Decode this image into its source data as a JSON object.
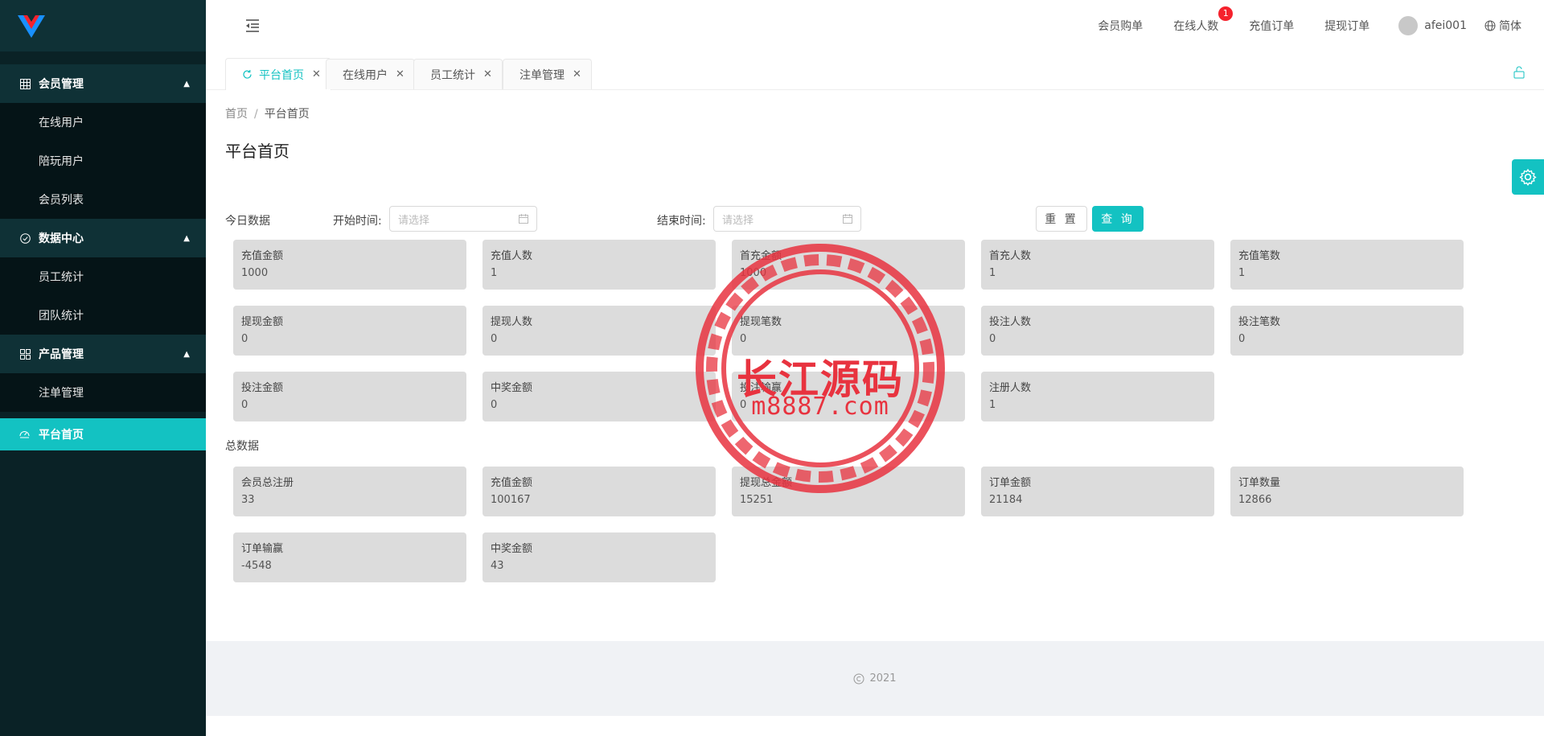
{
  "sidebar": {
    "groups": [
      {
        "label": "会员管理",
        "items": [
          "在线用户",
          "陪玩用户",
          "会员列表"
        ]
      },
      {
        "label": "数据中心",
        "items": [
          "员工统计",
          "团队统计"
        ]
      },
      {
        "label": "产品管理",
        "items": [
          "注单管理"
        ]
      }
    ],
    "active_item": "平台首页"
  },
  "header": {
    "nav": [
      "会员购单",
      "在线人数",
      "充值订单",
      "提现订单"
    ],
    "online_badge": "1",
    "user_name": "afei001",
    "language": "简体"
  },
  "tabs": [
    "平台首页",
    "在线用户",
    "员工统计",
    "注单管理"
  ],
  "breadcrumb": {
    "home": "首页",
    "current": "平台首页"
  },
  "page_title": "平台首页",
  "filter": {
    "section": "今日数据",
    "start_label": "开始时间:",
    "end_label": "结束时间:",
    "placeholder": "请选择",
    "reset": "重 置",
    "query": "查 询"
  },
  "today": [
    {
      "title": "充值金额",
      "value": "1000"
    },
    {
      "title": "充值人数",
      "value": "1"
    },
    {
      "title": "首充金额",
      "value": "1000"
    },
    {
      "title": "首充人数",
      "value": "1"
    },
    {
      "title": "充值笔数",
      "value": "1"
    },
    {
      "title": "提现金额",
      "value": "0"
    },
    {
      "title": "提现人数",
      "value": "0"
    },
    {
      "title": "提现笔数",
      "value": "0"
    },
    {
      "title": "投注人数",
      "value": "0"
    },
    {
      "title": "投注笔数",
      "value": "0"
    },
    {
      "title": "投注金额",
      "value": "0"
    },
    {
      "title": "中奖金额",
      "value": "0"
    },
    {
      "title": "投注输赢",
      "value": "0"
    },
    {
      "title": "注册人数",
      "value": "1"
    }
  ],
  "total_section": "总数据",
  "total": [
    {
      "title": "会员总注册",
      "value": "33"
    },
    {
      "title": "充值金额",
      "value": "100167"
    },
    {
      "title": "提现总金额",
      "value": "15251"
    },
    {
      "title": "订单金额",
      "value": "21184"
    },
    {
      "title": "订单数量",
      "value": "12866"
    },
    {
      "title": "订单输赢",
      "value": "-4548"
    },
    {
      "title": "中奖金额",
      "value": "43"
    }
  ],
  "footer": {
    "year": "2021"
  },
  "watermark": {
    "title": "长江源码",
    "url": "m8887.com"
  },
  "colors": {
    "accent": "#13c2c2",
    "sidebar": "#0a2226",
    "badge": "#f5222d",
    "stamp": "#e8333f"
  }
}
